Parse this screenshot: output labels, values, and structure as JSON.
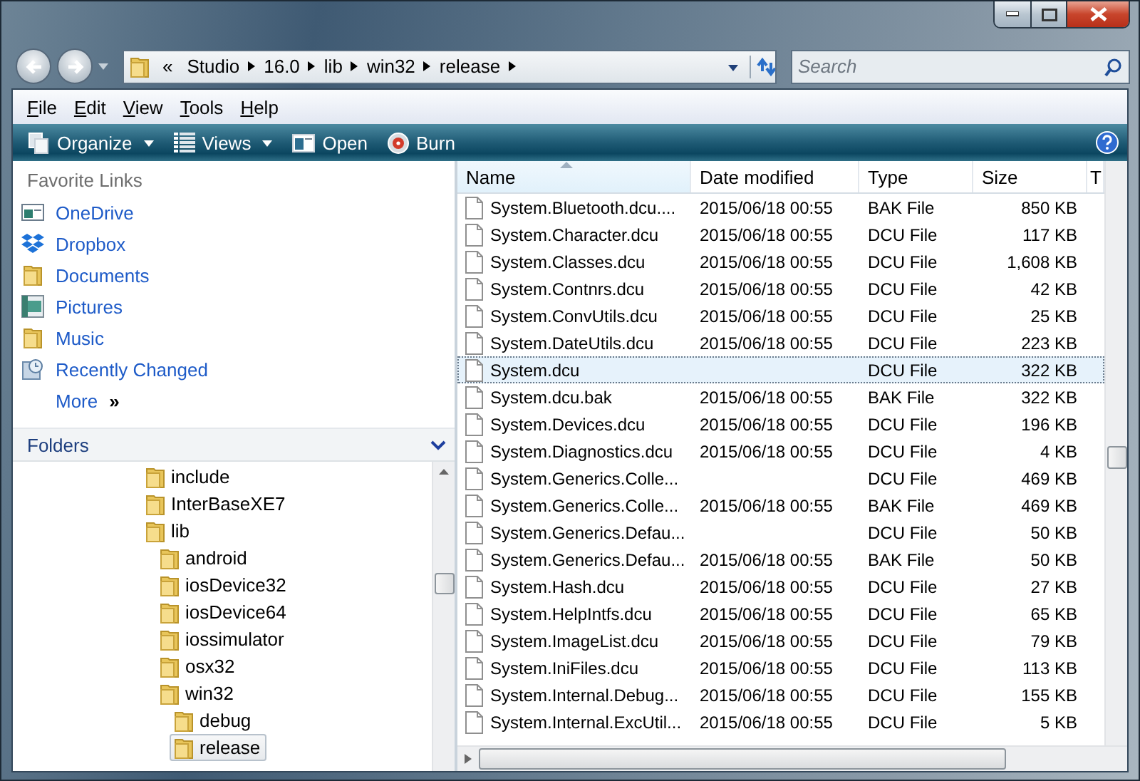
{
  "address": {
    "overflow": "«",
    "segments": [
      "Studio",
      "16.0",
      "lib",
      "win32",
      "release"
    ]
  },
  "search": {
    "placeholder": "Search"
  },
  "menu": [
    "File",
    "Edit",
    "View",
    "Tools",
    "Help"
  ],
  "commands": [
    {
      "label": "Organize",
      "kind": "organize",
      "dropdown": true
    },
    {
      "label": "Views",
      "kind": "views",
      "dropdown": true
    },
    {
      "label": "Open",
      "kind": "open",
      "dropdown": false
    },
    {
      "label": "Burn",
      "kind": "burn",
      "dropdown": false
    }
  ],
  "favorites": {
    "title": "Favorite Links",
    "items": [
      {
        "label": "OneDrive",
        "kind": "drive"
      },
      {
        "label": "Dropbox",
        "kind": "dropbox"
      },
      {
        "label": "Documents",
        "kind": "folder"
      },
      {
        "label": "Pictures",
        "kind": "pictures"
      },
      {
        "label": "Music",
        "kind": "folder"
      },
      {
        "label": "Recently Changed",
        "kind": "recent"
      }
    ],
    "more": "More",
    "more_glyph": "»"
  },
  "folders": {
    "title": "Folders",
    "tree": [
      {
        "label": "include",
        "selected": false
      },
      {
        "label": "InterBaseXE7",
        "selected": false
      },
      {
        "label": "lib",
        "selected": false,
        "children": [
          {
            "label": "android",
            "selected": false
          },
          {
            "label": "iosDevice32",
            "selected": false
          },
          {
            "label": "iosDevice64",
            "selected": false
          },
          {
            "label": "iossimulator",
            "selected": false
          },
          {
            "label": "osx32",
            "selected": false
          },
          {
            "label": "win32",
            "selected": false,
            "children": [
              {
                "label": "debug",
                "selected": false
              },
              {
                "label": "release",
                "selected": true
              }
            ]
          }
        ]
      }
    ]
  },
  "table": {
    "columns": [
      {
        "label": "Name",
        "sorted": true
      },
      {
        "label": "Date modified",
        "sorted": false
      },
      {
        "label": "Type",
        "sorted": false
      },
      {
        "label": "Size",
        "sorted": false
      },
      {
        "label": "T",
        "sorted": false
      }
    ],
    "rows": [
      {
        "name": "System.Bluetooth.dcu....",
        "date": "2015/06/18 00:55",
        "type": "BAK File",
        "size": "850 KB",
        "selected": false
      },
      {
        "name": "System.Character.dcu",
        "date": "2015/06/18 00:55",
        "type": "DCU File",
        "size": "117 KB",
        "selected": false
      },
      {
        "name": "System.Classes.dcu",
        "date": "2015/06/18 00:55",
        "type": "DCU File",
        "size": "1,608 KB",
        "selected": false
      },
      {
        "name": "System.Contnrs.dcu",
        "date": "2015/06/18 00:55",
        "type": "DCU File",
        "size": "42 KB",
        "selected": false
      },
      {
        "name": "System.ConvUtils.dcu",
        "date": "2015/06/18 00:55",
        "type": "DCU File",
        "size": "25 KB",
        "selected": false
      },
      {
        "name": "System.DateUtils.dcu",
        "date": "2015/06/18 00:55",
        "type": "DCU File",
        "size": "223 KB",
        "selected": false
      },
      {
        "name": "System.dcu",
        "type": "DCU File",
        "size": "322 KB",
        "selected": true
      },
      {
        "name": "System.dcu.bak",
        "date": "2015/06/18 00:55",
        "type": "BAK File",
        "size": "322 KB",
        "selected": false
      },
      {
        "name": "System.Devices.dcu",
        "date": "2015/06/18 00:55",
        "type": "DCU File",
        "size": "196 KB",
        "selected": false
      },
      {
        "name": "System.Diagnostics.dcu",
        "date": "2015/06/18 00:55",
        "type": "DCU File",
        "size": "4 KB",
        "selected": false
      },
      {
        "name": "System.Generics.Colle...",
        "type": "DCU File",
        "size": "469 KB",
        "selected": false
      },
      {
        "name": "System.Generics.Colle...",
        "date": "2015/06/18 00:55",
        "type": "BAK File",
        "size": "469 KB",
        "selected": false
      },
      {
        "name": "System.Generics.Defau...",
        "type": "DCU File",
        "size": "50 KB",
        "selected": false
      },
      {
        "name": "System.Generics.Defau...",
        "date": "2015/06/18 00:55",
        "type": "BAK File",
        "size": "50 KB",
        "selected": false
      },
      {
        "name": "System.Hash.dcu",
        "date": "2015/06/18 00:55",
        "type": "DCU File",
        "size": "27 KB",
        "selected": false
      },
      {
        "name": "System.HelpIntfs.dcu",
        "date": "2015/06/18 00:55",
        "type": "DCU File",
        "size": "65 KB",
        "selected": false
      },
      {
        "name": "System.ImageList.dcu",
        "date": "2015/06/18 00:55",
        "type": "DCU File",
        "size": "79 KB",
        "selected": false
      },
      {
        "name": "System.IniFiles.dcu",
        "date": "2015/06/18 00:55",
        "type": "DCU File",
        "size": "113 KB",
        "selected": false
      },
      {
        "name": "System.Internal.Debug...",
        "date": "2015/06/18 00:55",
        "type": "DCU File",
        "size": "155 KB",
        "selected": false
      },
      {
        "name": "System.Internal.ExcUtil...",
        "date": "2015/06/18 00:55",
        "type": "DCU File",
        "size": "5 KB",
        "selected": false
      }
    ]
  }
}
